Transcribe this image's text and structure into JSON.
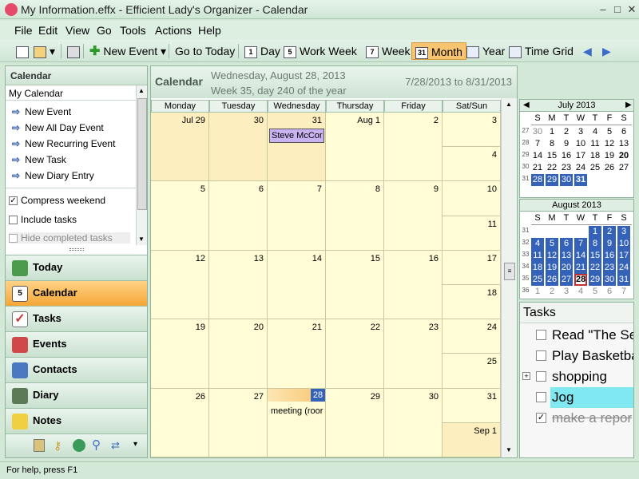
{
  "app": {
    "title": "My Information.effx - Efficient Lady's Organizer - Calendar"
  },
  "menu": [
    "File",
    "Edit",
    "View",
    "Go",
    "Tools",
    "Actions",
    "Help"
  ],
  "toolbar": {
    "new_event": "New Event",
    "go_to_today": "Go to Today",
    "day": "Day",
    "work_week": "Work Week",
    "week": "Week",
    "month": "Month",
    "year": "Year",
    "time_grid": "Time Grid",
    "day_icon": "1",
    "work_week_icon": "5",
    "week_icon": "7",
    "month_icon": "31"
  },
  "leftpanel": {
    "header": "Calendar",
    "calendar_name": "My Calendar",
    "links": [
      "New Event",
      "New All Day Event",
      "New Recurring Event",
      "New Task",
      "New Diary Entry"
    ],
    "options": [
      {
        "label": "Compress weekend",
        "checked": true
      },
      {
        "label": "Include tasks",
        "checked": false
      },
      {
        "label": "Hide completed tasks",
        "checked": false
      }
    ],
    "nav": [
      {
        "label": "Today",
        "icon": "house-icon",
        "color": "#4c9a4c"
      },
      {
        "label": "Calendar",
        "icon": "calendar-icon",
        "color": "#6b6b6b"
      },
      {
        "label": "Tasks",
        "icon": "checkmark-icon",
        "color": "#c23a3a"
      },
      {
        "label": "Events",
        "icon": "events-icon",
        "color": "#d04848"
      },
      {
        "label": "Contacts",
        "icon": "contacts-icon",
        "color": "#4a78c0"
      },
      {
        "label": "Diary",
        "icon": "book-icon",
        "color": "#5b7a55"
      },
      {
        "label": "Notes",
        "icon": "note-icon",
        "color": "#f0d040"
      }
    ],
    "active_nav": "Calendar"
  },
  "calendar": {
    "title": "Calendar",
    "date": "Wednesday, August 28, 2013",
    "week_info": "Week 35, day 240 of the year",
    "range": "7/28/2013 to 8/31/2013",
    "day_headers": [
      "Monday",
      "Tuesday",
      "Wednesday",
      "Thursday",
      "Friday",
      "Sat/Sun"
    ],
    "weeks": [
      {
        "days": [
          "Jul 29",
          "30",
          "31",
          "Aug 1",
          "2"
        ],
        "sat": "3",
        "sun": "4",
        "other": [
          true,
          true,
          true,
          false,
          false
        ]
      },
      {
        "days": [
          "5",
          "6",
          "7",
          "8",
          "9"
        ],
        "sat": "10",
        "sun": "11",
        "other": [
          false,
          false,
          false,
          false,
          false
        ]
      },
      {
        "days": [
          "12",
          "13",
          "14",
          "15",
          "16"
        ],
        "sat": "17",
        "sun": "18",
        "other": [
          false,
          false,
          false,
          false,
          false
        ]
      },
      {
        "days": [
          "19",
          "20",
          "21",
          "22",
          "23"
        ],
        "sat": "24",
        "sun": "25",
        "other": [
          false,
          false,
          false,
          false,
          false
        ]
      },
      {
        "days": [
          "26",
          "27",
          "28",
          "29",
          "30"
        ],
        "sat": "31",
        "sun": "Sep 1",
        "other": [
          false,
          false,
          false,
          false,
          false
        ]
      }
    ],
    "events": [
      {
        "week": 0,
        "day": 2,
        "text": "Steve McCor"
      },
      {
        "week": 4,
        "day": 2,
        "text": "meeting (roor"
      }
    ],
    "today": {
      "week": 4,
      "day": 2
    }
  },
  "minicals": [
    {
      "title": "July 2013",
      "dow": [
        "S",
        "M",
        "T",
        "W",
        "T",
        "F",
        "S"
      ],
      "weeks": [
        {
          "wk": "27",
          "days": [
            "30",
            "1",
            "2",
            "3",
            "4",
            "5",
            "6"
          ]
        },
        {
          "wk": "28",
          "days": [
            "7",
            "8",
            "9",
            "10",
            "11",
            "12",
            "13"
          ]
        },
        {
          "wk": "29",
          "days": [
            "14",
            "15",
            "16",
            "17",
            "18",
            "19",
            "20"
          ]
        },
        {
          "wk": "30",
          "days": [
            "21",
            "22",
            "23",
            "24",
            "25",
            "26",
            "27"
          ]
        },
        {
          "wk": "31",
          "days": [
            "28",
            "29",
            "30",
            "31",
            "",
            "",
            ""
          ]
        }
      ]
    },
    {
      "title": "August 2013",
      "dow": [
        "S",
        "M",
        "T",
        "W",
        "T",
        "F",
        "S"
      ],
      "weeks": [
        {
          "wk": "31",
          "days": [
            "",
            "",
            "",
            "",
            "1",
            "2",
            "3"
          ]
        },
        {
          "wk": "32",
          "days": [
            "4",
            "5",
            "6",
            "7",
            "8",
            "9",
            "10"
          ]
        },
        {
          "wk": "33",
          "days": [
            "11",
            "12",
            "13",
            "14",
            "15",
            "16",
            "17"
          ]
        },
        {
          "wk": "34",
          "days": [
            "18",
            "19",
            "20",
            "21",
            "22",
            "23",
            "24"
          ]
        },
        {
          "wk": "35",
          "days": [
            "25",
            "26",
            "27",
            "28",
            "29",
            "30",
            "31"
          ]
        },
        {
          "wk": "36",
          "days": [
            "1",
            "2",
            "3",
            "4",
            "5",
            "6",
            "7"
          ]
        }
      ]
    }
  ],
  "tasks": {
    "title": "Tasks",
    "items": [
      {
        "text": "Read \"The Se",
        "checked": false
      },
      {
        "text": "Play Basketba",
        "checked": false
      },
      {
        "text": "shopping",
        "checked": false,
        "expandable": true
      },
      {
        "text": "Jog",
        "checked": false,
        "highlight": true
      },
      {
        "text": "make a repor",
        "checked": true,
        "done": true
      }
    ]
  },
  "status": "For help, press F1",
  "colors": {
    "accent": "#f5a636",
    "selection": "#3362b8",
    "event": "#c9b3f0",
    "today_header": "#f7c572"
  }
}
